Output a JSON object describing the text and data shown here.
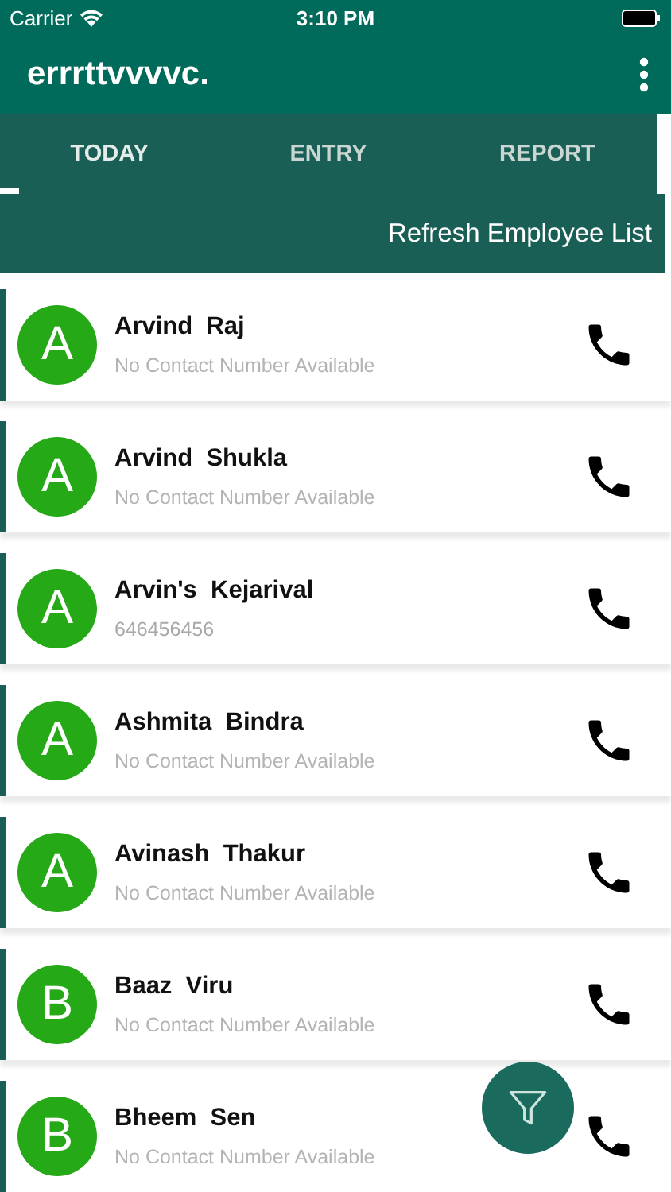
{
  "status_bar": {
    "carrier": "Carrier",
    "time": "3:10 PM"
  },
  "app_bar": {
    "title": "errrttvvvvc."
  },
  "tabs": [
    {
      "label": "TODAY",
      "selected": true
    },
    {
      "label": "ENTRY",
      "selected": false
    },
    {
      "label": "REPORT",
      "selected": false
    }
  ],
  "refresh_button": "Refresh Employee List",
  "employees": [
    {
      "initial": "A",
      "name": "Arvind  Raj",
      "contact": "No Contact Number Available",
      "has_number": false
    },
    {
      "initial": "A",
      "name": "Arvind  Shukla",
      "contact": "No Contact Number Available",
      "has_number": false
    },
    {
      "initial": "A",
      "name": "Arvin's  Kejarival",
      "contact": "646456456",
      "has_number": true
    },
    {
      "initial": "A",
      "name": "Ashmita  Bindra",
      "contact": "No Contact Number Available",
      "has_number": false
    },
    {
      "initial": "A",
      "name": "Avinash  Thakur",
      "contact": "No Contact Number Available",
      "has_number": false
    },
    {
      "initial": "B",
      "name": "Baaz  Viru",
      "contact": "No Contact Number Available",
      "has_number": false
    },
    {
      "initial": "B",
      "name": "Bheem  Sen",
      "contact": "No Contact Number Available",
      "has_number": false
    }
  ]
}
